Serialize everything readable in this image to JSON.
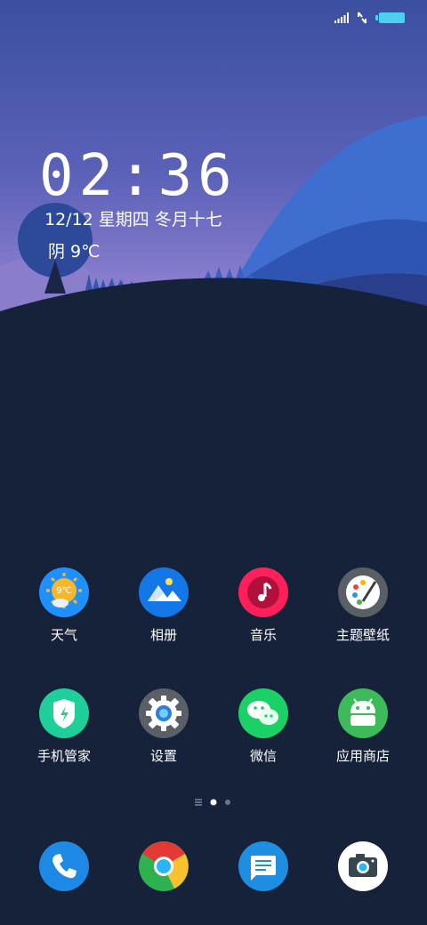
{
  "status_bar": {
    "signal_icon": "signal-bars-icon",
    "data_icon": "data-arrows-icon",
    "battery_icon": "battery-icon",
    "accent_battery": "#4dd0f0"
  },
  "lock_widget": {
    "time": "02:36",
    "date": "12/12 星期四 冬月十七",
    "weather": "阴 9℃"
  },
  "home": {
    "row1": [
      {
        "label": "天气",
        "icon": "weather-icon",
        "color": "#1e90ff",
        "badge": "9℃"
      },
      {
        "label": "相册",
        "icon": "gallery-icon",
        "color": "#1477e8"
      },
      {
        "label": "音乐",
        "icon": "music-icon",
        "color": "#ff1f5a"
      },
      {
        "label": "主题壁纸",
        "icon": "themes-palette-icon",
        "color": "#5a5f66"
      }
    ],
    "row2": [
      {
        "label": "手机管家",
        "icon": "phone-manager-shield-icon",
        "color": "#1fcf9a"
      },
      {
        "label": "设置",
        "icon": "settings-gear-icon",
        "color": "#5b6068"
      },
      {
        "label": "微信",
        "icon": "wechat-icon",
        "color": "#1bd166"
      },
      {
        "label": "应用商店",
        "icon": "app-store-android-icon",
        "color": "#3dbb5a"
      }
    ],
    "page_indicator": {
      "pages": 3,
      "current": 2
    }
  },
  "dock": [
    {
      "icon": "phone-icon",
      "color": "#1e88e5"
    },
    {
      "icon": "browser-icon",
      "color": "#2eb24f"
    },
    {
      "icon": "messages-icon",
      "color": "#1e8fe0"
    },
    {
      "icon": "camera-icon",
      "color": "#ffffff"
    }
  ]
}
